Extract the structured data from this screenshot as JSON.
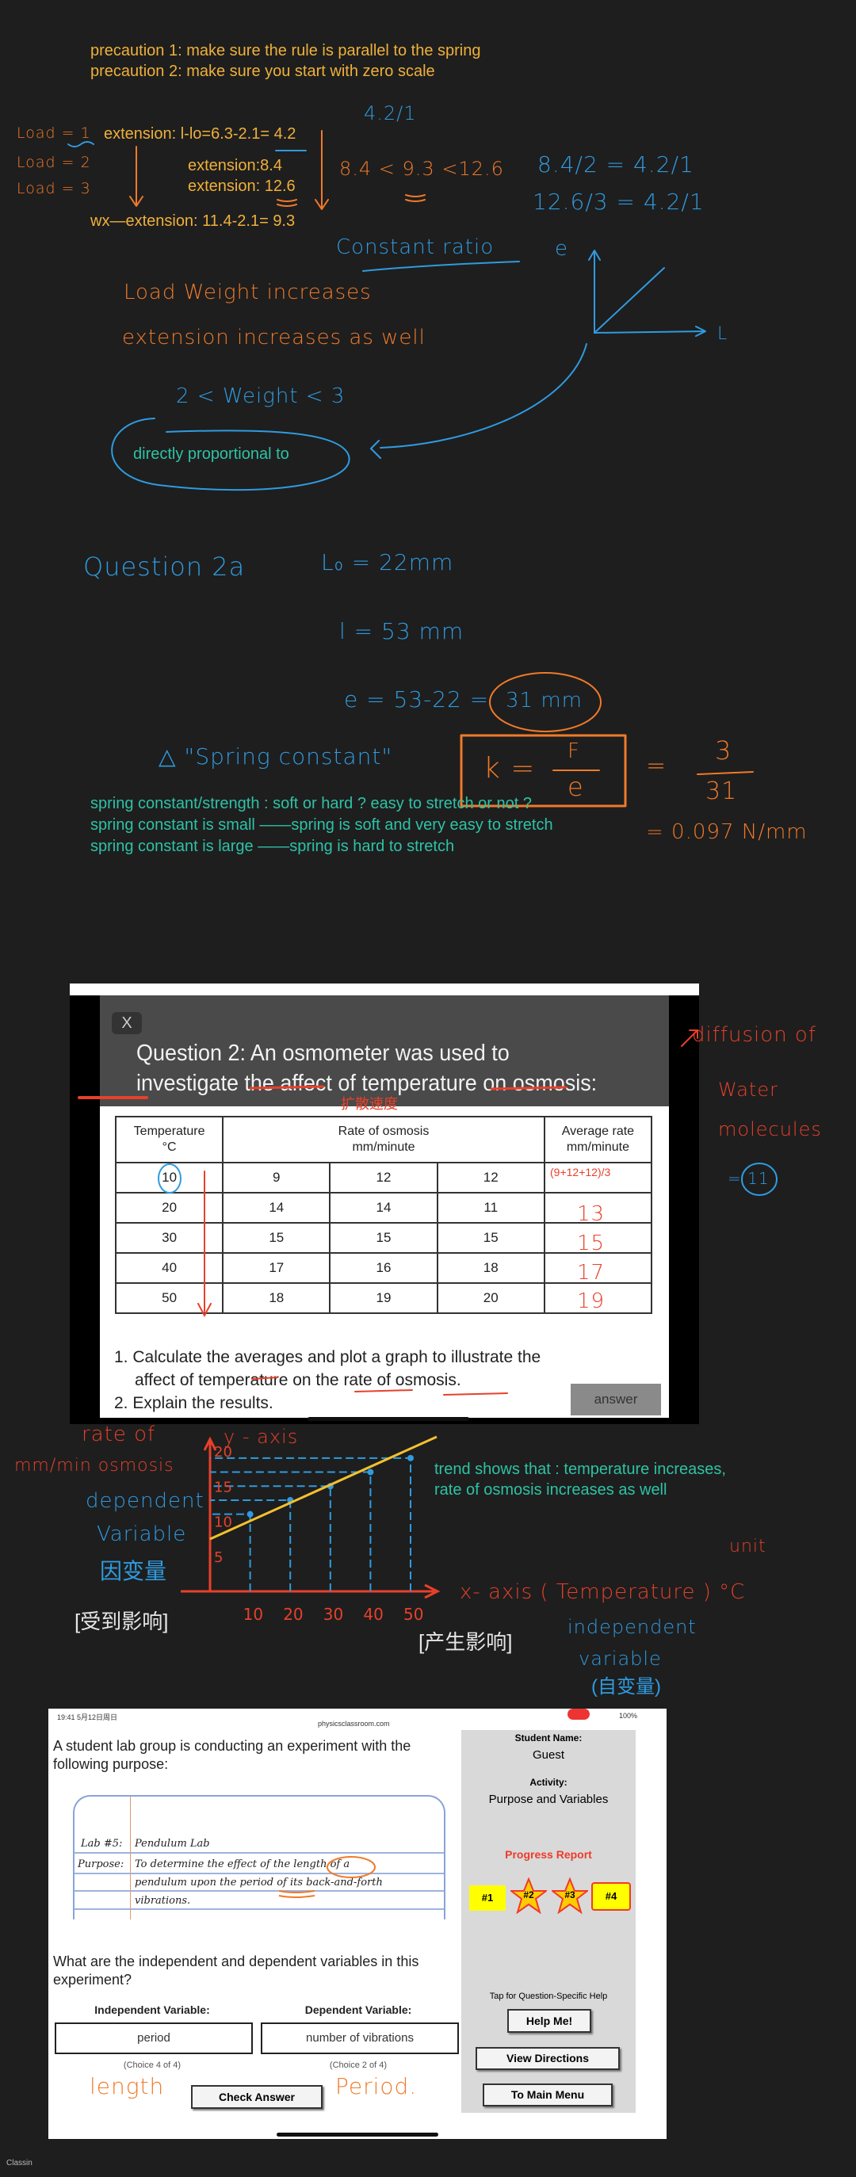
{
  "notes": {
    "precaution_1": "precaution 1: make sure the rule is parallel to the spring",
    "precaution_2": "precaution 2: make sure you start with zero scale",
    "ratio_top": "4.2/1",
    "load_1": "Load = 1",
    "load_2": "Load = 2",
    "load_3": "Load = 3",
    "extension_1": "extension: l-lo=6.3-2.1= 4.2",
    "extension_2": "extension:8.4",
    "extension_3": "extension: 12.6",
    "wx_extension": "wx—extension: 11.4-2.1= 9.3",
    "inequality": "8.4 < 9.3 <12.6",
    "ratio_1": "8.4/2 = 4.2/1",
    "ratio_2": "12.6/3 = 4.2/1",
    "constant_ratio": "Constant ratio",
    "axis_e": "e",
    "axis_l": "L",
    "load_weight_increases": "Load Weight increases",
    "extension_increases": "extension increases as well",
    "weight_range": "2 < Weight < 3",
    "directly_proportional": "directly proportional to",
    "question_2a": "Question 2a",
    "l0": "L₀ = 22mm",
    "l": "l = 53 mm",
    "e_calc": "e = 53-22 =",
    "e_result": "31 mm",
    "spring_constant_label": "△ \"Spring constant\"",
    "formula_k": "k =",
    "formula_f": "F",
    "formula_e": "e",
    "equals": "=",
    "k_num": "3",
    "k_den": "31",
    "k_value": "= 0.097 N/mm",
    "spring_lines": [
      "spring constant/strength : soft or hard ? easy to stretch or not ?",
      "spring constant is small ——spring is soft and very easy to stretch",
      "spring constant is large ——spring is hard to stretch"
    ]
  },
  "question2": {
    "close": "X",
    "title_line1": "Question 2: An osmometer was used to",
    "title_line2": "investigate the affect of temperature on osmosis:",
    "table": {
      "header_temp": "Temperature\n°C",
      "header_rate": "Rate of osmosis\nmm/minute",
      "header_avg": "Average rate\nmm/minute",
      "rows": [
        [
          "10",
          "9",
          "12",
          "12"
        ],
        [
          "20",
          "14",
          "14",
          "11"
        ],
        [
          "30",
          "15",
          "15",
          "15"
        ],
        [
          "40",
          "17",
          "16",
          "18"
        ],
        [
          "50",
          "18",
          "19",
          "20"
        ]
      ]
    },
    "item_1a": "1. Calculate the averages and plot a graph to illustrate the",
    "item_1b": "affect of temperature on the rate of osmosis.",
    "item_2": "2. Explain the results.",
    "answer_button": "answer",
    "annotations": {
      "diffusion_of": "diffusion of",
      "water": "Water",
      "molecules": "molecules",
      "chinese_rate": "扩散速度",
      "avg_formula": "(9+12+12)/3",
      "avg_first": "= 11",
      "avg_rest": [
        "13",
        "15",
        "17",
        "19"
      ]
    }
  },
  "graph": {
    "rate_of": "rate of",
    "osmosis": "mm/min  osmosis",
    "dependent": "dependent",
    "variable": "Variable",
    "dependent_cn": "因变量",
    "affected_cn": "[受到影响]",
    "y_axis_label": "y - axis",
    "x_axis_label": "x- axis  ( Temperature ) °C",
    "unit": "unit",
    "affecting_cn": "[产生影响]",
    "independent": "independent",
    "variable_2": "variable",
    "independent_cn": "(自变量)",
    "trend_1": "trend shows that : temperature increases,",
    "trend_2": "rate of osmosis increases as well",
    "x_ticks": [
      "10",
      "20",
      "30",
      "40",
      "50"
    ],
    "y_ticks": [
      "5",
      "10",
      "15",
      "20"
    ],
    "points": [
      [
        10,
        11
      ],
      [
        20,
        13
      ],
      [
        30,
        15
      ],
      [
        40,
        17
      ],
      [
        50,
        19
      ]
    ],
    "colors": {
      "axis": "#e8402a",
      "line": "#f2c12e",
      "guides": "#2f9be0"
    }
  },
  "lab": {
    "status_time": "19:41  5月12日周日",
    "url": "physicsclassroom.com",
    "battery": "100%",
    "intro_1": "A student lab group is conducting an experiment with the",
    "intro_2": "following purpose:",
    "lab_label": "Lab #5:",
    "lab_name": "Pendulum Lab",
    "purpose_label": "Purpose:",
    "purpose_1": "To determine the effect of the length of a",
    "purpose_2": "pendulum upon the period of its back-and-forth",
    "purpose_3": "vibrations.",
    "question_1": "What are the independent and dependent variables in this",
    "question_2": "experiment?",
    "independent_label": "Independent Variable:",
    "dependent_label": "Dependent Variable:",
    "independent_value": "period",
    "dependent_value": "number of vibrations",
    "independent_choice": "(Choice 4 of 4)",
    "dependent_choice": "(Choice 2 of 4)",
    "check_answer": "Check Answer",
    "hw_length": "length",
    "hw_period": "Period.",
    "student_name_label": "Student Name:",
    "student_name": "Guest",
    "activity_label": "Activity:",
    "activity": "Purpose and Variables",
    "progress_report": "Progress Report",
    "badges": [
      "#1",
      "#2",
      "#3",
      "#4"
    ],
    "help_hint": "Tap for Question-Specific Help",
    "help_button": "Help Me!",
    "directions_button": "View Directions",
    "menu_button": "To Main Menu"
  },
  "app_label": "Classin"
}
